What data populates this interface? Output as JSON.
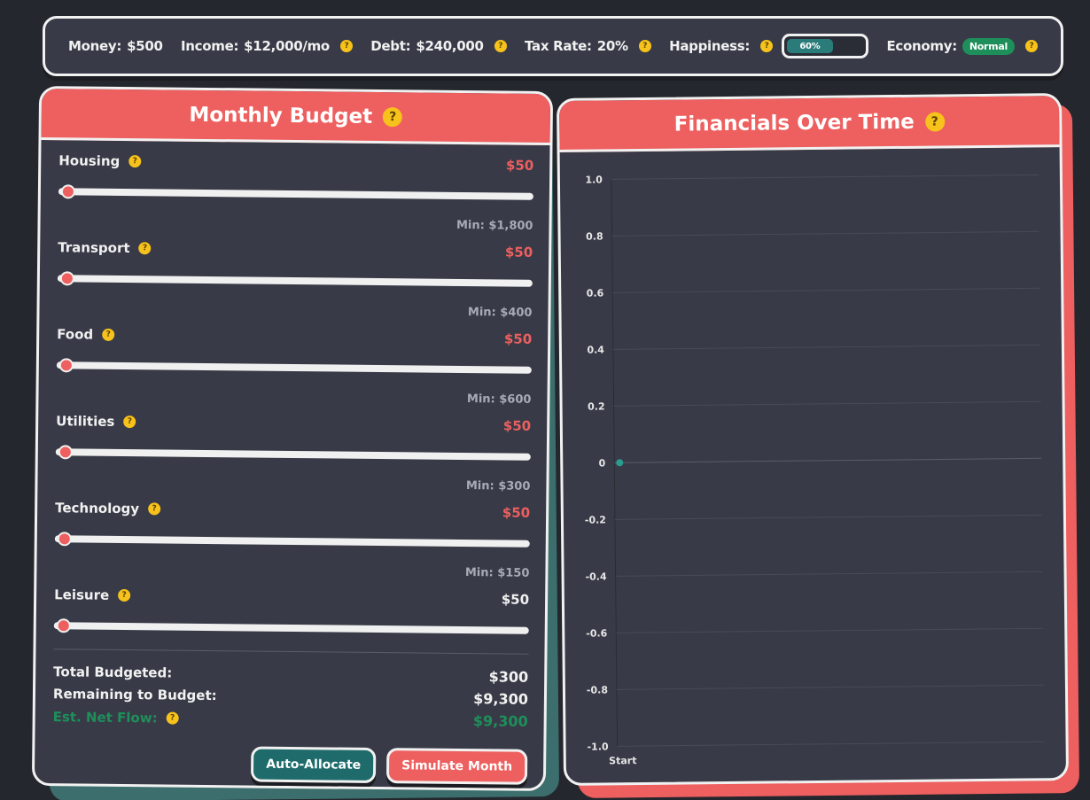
{
  "status": {
    "money_label": "Money:",
    "money_value": "$500",
    "income_label": "Income:",
    "income_value": "$12,000/mo",
    "debt_label": "Debt:",
    "debt_value": "$240,000",
    "tax_label": "Tax Rate:",
    "tax_value": "20%",
    "happiness_label": "Happiness:",
    "happiness_value": "60%",
    "happiness_fraction": 0.6,
    "economy_label": "Economy:",
    "economy_value": "Normal"
  },
  "help_glyph": "?",
  "budget": {
    "title": "Monthly Budget",
    "categories": [
      {
        "name": "Housing",
        "value": "$50",
        "min": "Min: $1,800",
        "fraction": 0.0,
        "below_min": true
      },
      {
        "name": "Transport",
        "value": "$50",
        "min": "Min: $400",
        "fraction": 0.0,
        "below_min": true
      },
      {
        "name": "Food",
        "value": "$50",
        "min": "Min: $600",
        "fraction": 0.0,
        "below_min": true
      },
      {
        "name": "Utilities",
        "value": "$50",
        "min": "Min: $300",
        "fraction": 0.0,
        "below_min": true
      },
      {
        "name": "Technology",
        "value": "$50",
        "min": "Min: $150",
        "fraction": 0.0,
        "below_min": true
      },
      {
        "name": "Leisure",
        "value": "$50",
        "min": "",
        "fraction": 0.0,
        "below_min": false
      }
    ],
    "total_label": "Total Budgeted:",
    "total_value": "$300",
    "remaining_label": "Remaining to Budget:",
    "remaining_value": "$9,300",
    "netflow_label": "Est. Net Flow:",
    "netflow_value": "$9,300",
    "auto_allocate_label": "Auto-Allocate",
    "simulate_label": "Simulate Month"
  },
  "chart": {
    "title": "Financials Over Time"
  },
  "colors": {
    "accent_red": "#ee5f5f",
    "teal": "#1f6b6b",
    "green": "#1e8f5a",
    "help_yellow": "#f7c21b"
  },
  "chart_data": {
    "type": "line",
    "x": [
      "Start"
    ],
    "series": [
      {
        "values": [
          0
        ]
      }
    ],
    "ylim": [
      -1.0,
      1.0
    ],
    "yticks": [
      "1.0",
      "0.8",
      "0.6",
      "0.4",
      "0.2",
      "0",
      "-0.2",
      "-0.4",
      "-0.6",
      "-0.8",
      "-1.0"
    ],
    "grid": true,
    "title": "",
    "xlabel": "",
    "ylabel": ""
  }
}
